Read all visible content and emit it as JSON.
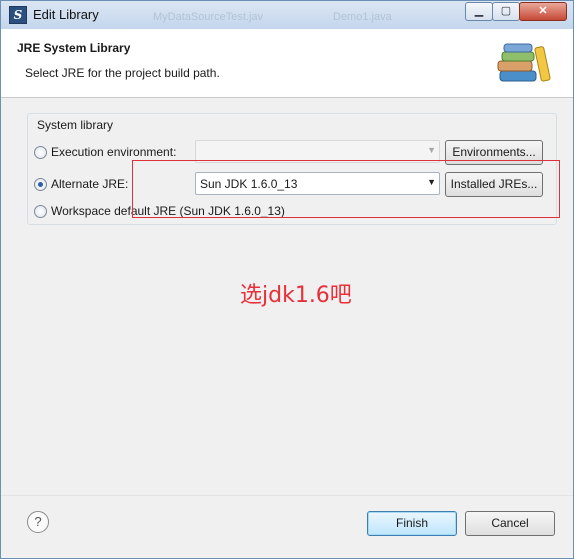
{
  "window": {
    "title": "Edit Library",
    "background_titles": [
      "MyDataSourceTest.jav",
      "Demo1.java"
    ]
  },
  "header": {
    "title": "JRE System Library",
    "description": "Select JRE for the project build path."
  },
  "system_library": {
    "group_label": "System library",
    "execution_environment": {
      "label": "Execution environment:",
      "selected": false,
      "value": ""
    },
    "alternate_jre": {
      "label": "Alternate JRE:",
      "selected": true,
      "value": "Sun JDK 1.6.0_13"
    },
    "workspace_default": {
      "label": "Workspace default JRE (Sun JDK 1.6.0_13)",
      "selected": false
    },
    "environments_button": "Environments...",
    "installed_jres_button": "Installed JREs..."
  },
  "annotation": {
    "text": "选jdk1.6吧",
    "color": "#e8303a"
  },
  "footer": {
    "help_symbol": "?",
    "finish_label": "Finish",
    "cancel_label": "Cancel"
  },
  "icons": [
    "eclipse-s-icon",
    "books-icon",
    "help-icon",
    "minimize-icon",
    "maximize-icon",
    "close-icon"
  ]
}
